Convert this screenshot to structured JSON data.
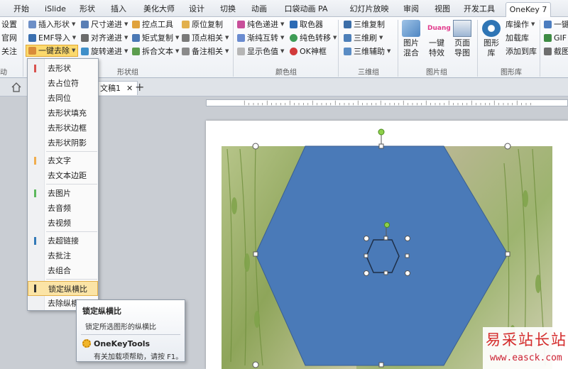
{
  "tabs": [
    "开始",
    "iSlide",
    "形状",
    "插入",
    "美化大师",
    "设计",
    "切换",
    "动画",
    "口袋动画 PA",
    "幻灯片放映",
    "审阅",
    "视图",
    "开发工具",
    "OneKey 7"
  ],
  "ribbon": {
    "left_col": [
      "设置",
      "官网",
      "关注"
    ],
    "shape_group": {
      "col1": [
        "插入形状",
        "EMF导入",
        "一键去除"
      ],
      "col2": [
        "尺寸递进",
        "对齐递进",
        "旋转递进"
      ],
      "col3": [
        "控点工具",
        "矩式复制",
        "拆合文本"
      ],
      "col4": [
        "原位复制",
        "顶点相关",
        "备注相关"
      ],
      "label": "形状组"
    },
    "color_group": {
      "col1": [
        "纯色递进",
        "渐纯互转",
        "显示色值"
      ],
      "col2": [
        "取色器",
        "纯色转移",
        "OK神框"
      ],
      "label": "颜色组"
    },
    "threed_group": {
      "items": [
        "三维复制",
        "三维刷",
        "三维辅助"
      ],
      "label": "三维组"
    },
    "image_group": {
      "btn1": [
        "图片",
        "混合"
      ],
      "btn2": [
        "一键",
        "特效"
      ],
      "btn3": [
        "页面",
        "导图"
      ],
      "duang": "Duang",
      "label": "图片组"
    },
    "shape_lib": {
      "btn": [
        "图形",
        "库"
      ],
      "items": [
        "库操作",
        "加载库",
        "添加到库"
      ],
      "label": "图形库"
    },
    "right_col": [
      "一键",
      "GIF",
      "截图"
    ],
    "left_label": "动"
  },
  "docbar": {
    "doc_name": "文稿1",
    "close": "✕",
    "add": "+"
  },
  "dropdown": {
    "items": [
      {
        "label": "去形状",
        "bar": "#d9534f"
      },
      {
        "label": "去占位符",
        "bar": ""
      },
      {
        "label": "去同位",
        "bar": ""
      },
      {
        "label": "去形状填充",
        "bar": ""
      },
      {
        "label": "去形状边框",
        "bar": ""
      },
      {
        "label": "去形状阴影",
        "bar": ""
      },
      {
        "label": "去文字",
        "bar": "#f0ad4e"
      },
      {
        "label": "去文本边距",
        "bar": ""
      },
      {
        "label": "去图片",
        "bar": "#5cb85c"
      },
      {
        "label": "去音频",
        "bar": ""
      },
      {
        "label": "去视频",
        "bar": ""
      },
      {
        "label": "去超链接",
        "bar": "#337ab7"
      },
      {
        "label": "去批注",
        "bar": ""
      },
      {
        "label": "去组合",
        "bar": ""
      },
      {
        "label": "锁定纵横比",
        "bar": "#333333"
      },
      {
        "label": "去除纵横",
        "bar": ""
      }
    ]
  },
  "tooltip": {
    "title": "锁定纵横比",
    "desc": "锁定所选图形的纵横比",
    "brand": "OneKeyTools",
    "help": "有关加载项帮助，请按 F1。"
  },
  "watermark": {
    "top": "易采站长站",
    "bottom": "www.easck.com"
  },
  "colors": {
    "hexagon": "#4a7ab8",
    "hexagon_stroke": "#3a5f90",
    "accent": "#fbd96d"
  }
}
